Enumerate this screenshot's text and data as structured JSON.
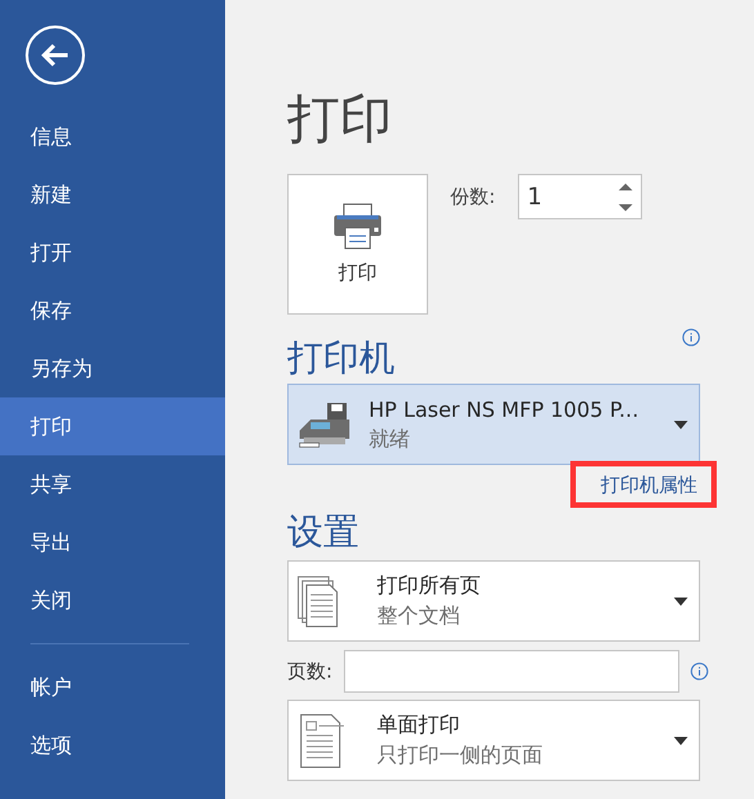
{
  "sidebar": {
    "items": [
      {
        "label": "信息",
        "selected": false
      },
      {
        "label": "新建",
        "selected": false
      },
      {
        "label": "打开",
        "selected": false
      },
      {
        "label": "保存",
        "selected": false
      },
      {
        "label": "另存为",
        "selected": false
      },
      {
        "label": "打印",
        "selected": true
      },
      {
        "label": "共享",
        "selected": false
      },
      {
        "label": "导出",
        "selected": false
      },
      {
        "label": "关闭",
        "selected": false
      }
    ],
    "footer_items": [
      {
        "label": "帐户",
        "selected": false
      },
      {
        "label": "选项",
        "selected": false
      }
    ]
  },
  "title": "打印",
  "print_button": {
    "label": "打印"
  },
  "copies": {
    "label": "份数:",
    "value": "1"
  },
  "printer": {
    "heading": "打印机",
    "name": "HP Laser NS MFP 1005 P...",
    "status": "就绪",
    "properties_link": {
      "label": "打印机属性",
      "highlighted": true
    }
  },
  "settings": {
    "heading": "设置",
    "pages_label": "页数:",
    "dropdowns": [
      {
        "kind": "pages",
        "title": "打印所有页",
        "subtitle": "整个文档"
      },
      {
        "kind": "sides",
        "title": "单面打印",
        "subtitle": "只打印一侧的页面"
      }
    ]
  }
}
